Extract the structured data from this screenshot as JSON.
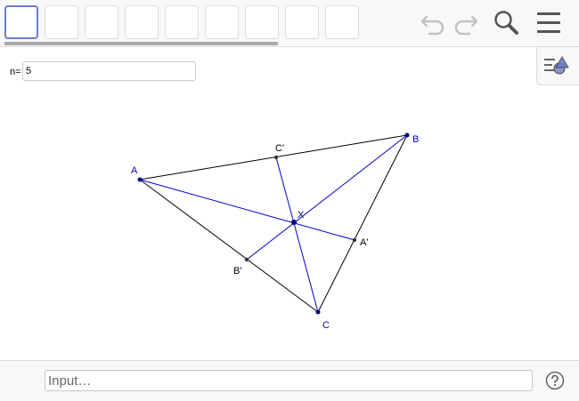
{
  "toolbar": {
    "tools": [
      "tool-1",
      "tool-2",
      "tool-3",
      "tool-4",
      "tool-5",
      "tool-6",
      "tool-7",
      "tool-8",
      "tool-9"
    ],
    "selected_tool_index": 0,
    "icons": [
      "undo-icon",
      "redo-icon",
      "search-icon",
      "menu-icon"
    ]
  },
  "slider": {
    "label": "n=",
    "value": "5"
  },
  "construction": {
    "colors": {
      "segment": "#000000",
      "cevian": "#0000cc",
      "point": "#000080"
    },
    "points": [
      {
        "name": "A",
        "label": "A",
        "color": "#0000cc"
      },
      {
        "name": "B",
        "label": "B",
        "color": "#0000cc"
      },
      {
        "name": "C",
        "label": "C",
        "color": "#0000cc"
      },
      {
        "name": "A'",
        "label": "A'",
        "color": "#000000"
      },
      {
        "name": "B'",
        "label": "B'",
        "color": "#000000"
      },
      {
        "name": "C'",
        "label": "C'",
        "color": "#000000"
      },
      {
        "name": "X",
        "label": "X",
        "color": "#0000cc"
      }
    ]
  },
  "input_bar": {
    "placeholder": "Input…",
    "help_icon": "help-icon"
  }
}
